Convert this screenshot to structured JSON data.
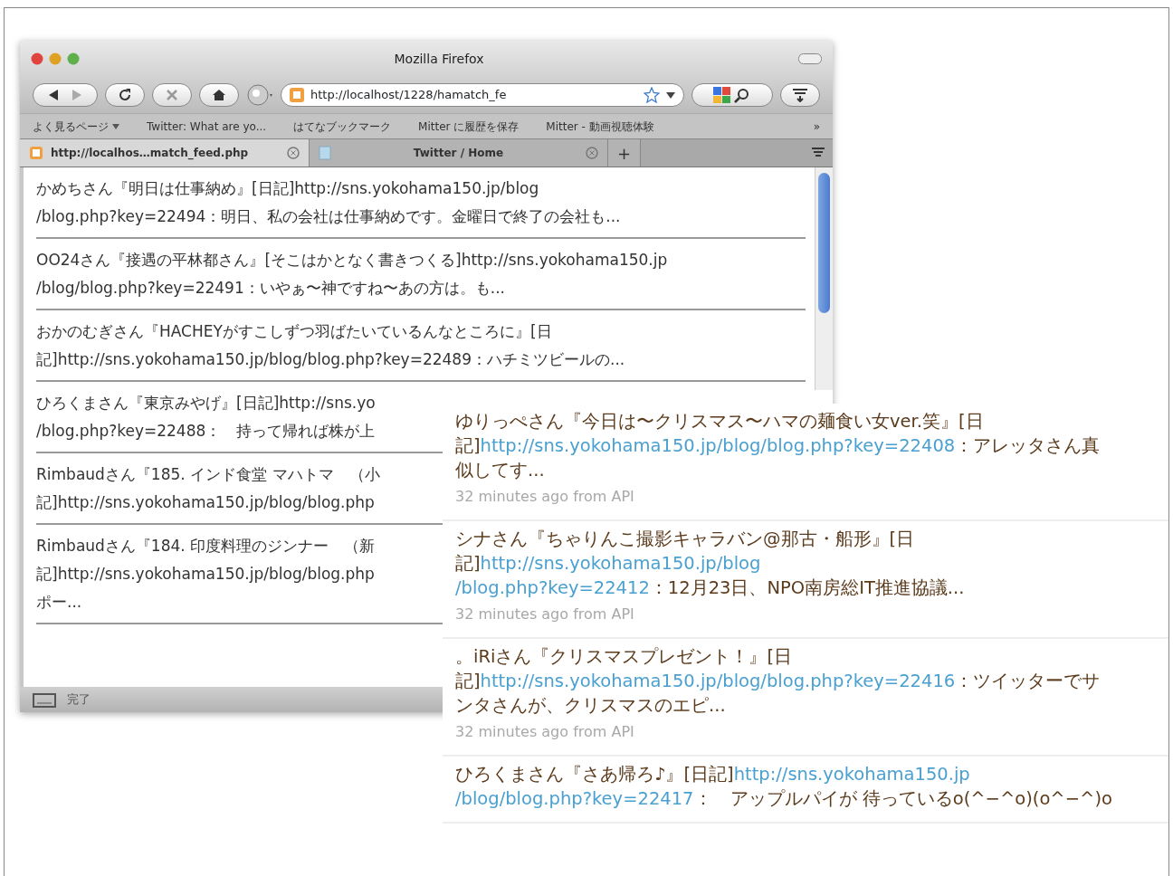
{
  "window": {
    "title": "Mozilla Firefox"
  },
  "toolbar": {
    "url": "http://localhost/1228/hamatch_fe"
  },
  "bookmarks": [
    {
      "label": "よく見るページ",
      "kind": "folder"
    },
    {
      "label": "Twitter: What are yo...",
      "kind": "link"
    },
    {
      "label": "はてなブックマーク",
      "kind": "link"
    },
    {
      "label": "Mitter に履歴を保存",
      "kind": "link"
    },
    {
      "label": "Mitter - 動画視聴体験",
      "kind": "link"
    }
  ],
  "bookmarks_more": "»",
  "tabs": [
    {
      "label": "http://localhos…match_feed.php",
      "selected": true,
      "kind": "feed"
    },
    {
      "label": "Twitter / Home",
      "selected": false,
      "kind": "page"
    }
  ],
  "new_tab": "+",
  "feed": [
    {
      "lines": [
        "かめちさん『明日は仕事納め』[日記]http://sns.yokohama150.jp/blog",
        "/blog.php?key=22494：明日、私の会社は仕事納めです。金曜日で終了の会社も..."
      ]
    },
    {
      "lines": [
        "OO24さん『接遇の平林都さん』[そこはかとなく書きつくる]http://sns.yokohama150.jp",
        "/blog/blog.php?key=22491：いやぁ〜神ですね〜あの方は。も..."
      ]
    },
    {
      "lines": [
        "おかのむぎさん『HACHEYがすこしずつ羽ばたいているんなところに』[日",
        "記]http://sns.yokohama150.jp/blog/blog.php?key=22489：ハチミツビールの..."
      ]
    },
    {
      "lines": [
        "ひろくまさん『東京みやげ』[日記]http://sns.yo",
        "/blog.php?key=22488：　持って帰れば株が上"
      ]
    },
    {
      "lines": [
        "Rimbaudさん『185. インド食堂 マハトマ　（小",
        "記]http://sns.yokohama150.jp/blog/blog.php"
      ]
    },
    {
      "lines": [
        "Rimbaudさん『184. 印度料理のジンナー　（新",
        "記]http://sns.yokohama150.jp/blog/blog.php",
        "ポー..."
      ]
    }
  ],
  "status_bar": {
    "text": "完了"
  },
  "tweets": [
    {
      "pre": "ゆりっぺさん『今日は〜クリスマス〜ハマの麺食い女ver.笑』[日記]",
      "link": [
        "http://sns.yokohama150.jp/blog/blog.php?key=22408"
      ],
      "post": "：アレッタさん真似してす...",
      "meta": "32 minutes ago from API"
    },
    {
      "pre": "シナさん『ちゃりんこ撮影キャラバン@那古・船形』[日記]",
      "link": [
        "http://sns.yokohama150.jp/blog",
        "/blog.php?key=22412"
      ],
      "post": "：12月23日、NPO南房総IT推進協議...",
      "meta": "32 minutes ago from API"
    },
    {
      "pre": "。iRiさん『クリスマスプレゼント！』[日記]",
      "link": [
        "http://sns.yokohama150.jp/blog/blog.php?key=22416"
      ],
      "post": "：ツイッターでサンタさんが、クリスマスのエピ...",
      "meta": "32 minutes ago from API"
    },
    {
      "pre": "ひろくまさん『さあ帰ろ♪』[日記]",
      "link": [
        "http://sns.yokohama150.jp",
        "/blog/blog.php?key=22417"
      ],
      "post": "：　アップルパイが 待っているo(^−^o)(o^−^)o"
    }
  ]
}
